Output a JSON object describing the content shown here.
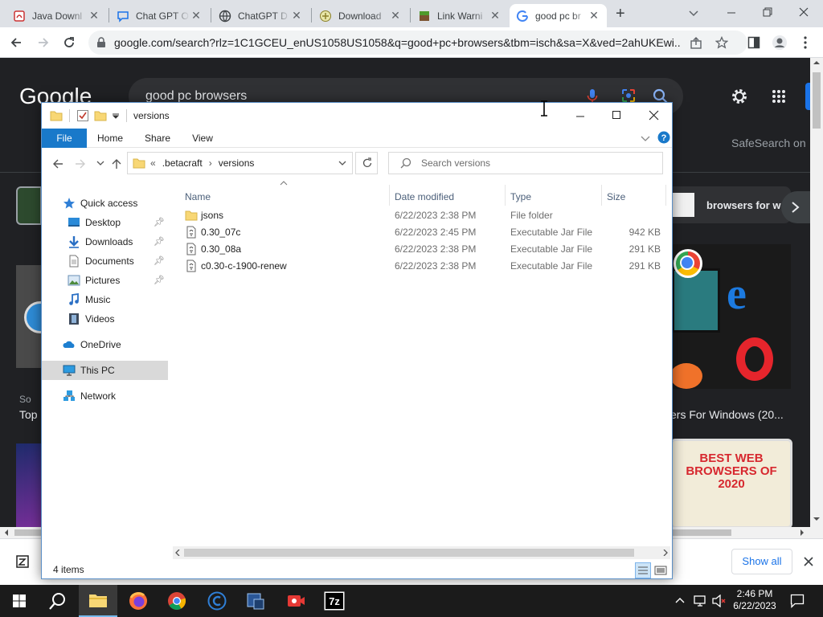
{
  "browser": {
    "tabs": [
      {
        "title": "Java Downl",
        "active": false
      },
      {
        "title": "Chat GPT O",
        "active": false
      },
      {
        "title": "ChatGPT D",
        "active": false
      },
      {
        "title": "Download",
        "active": false
      },
      {
        "title": "Link Warni",
        "active": false
      },
      {
        "title": "good pc br",
        "active": true
      }
    ],
    "new_tab": "+",
    "url": "google.com/search?rlz=1C1GCEU_enUS1058US1058&q=good+pc+browsers&tbm=isch&sa=X&ved=2ahUKEwi..."
  },
  "google": {
    "logo": "Google",
    "query": "good pc browsers",
    "safesearch": "SafeSearch on",
    "chip_text": "browsers for w",
    "left_caption_source": "So",
    "left_caption_title": "Top",
    "right_caption": "ers For Windows (20...",
    "best_web_line1": "BEST WEB",
    "best_web_line2": "BROWSERS OF",
    "best_web_line3": "2020",
    "show_all": "Show all"
  },
  "explorer": {
    "title": "versions",
    "ribbon": {
      "file": "File",
      "home": "Home",
      "share": "Share",
      "view": "View"
    },
    "breadcrumb": {
      "overflow": "«",
      "parent": ".betacraft",
      "sep": "›",
      "current": "versions"
    },
    "search_placeholder": "Search versions",
    "nav": {
      "quick_access": "Quick access",
      "desktop": "Desktop",
      "downloads": "Downloads",
      "documents": "Documents",
      "pictures": "Pictures",
      "music": "Music",
      "videos": "Videos",
      "onedrive": "OneDrive",
      "this_pc": "This PC",
      "network": "Network"
    },
    "columns": {
      "name": "Name",
      "date": "Date modified",
      "type": "Type",
      "size": "Size"
    },
    "files": [
      {
        "name": "jsons",
        "date": "6/22/2023 2:38 PM",
        "type": "File folder",
        "size": ""
      },
      {
        "name": "0.30_07c",
        "date": "6/22/2023 2:45 PM",
        "type": "Executable Jar File",
        "size": "942 KB"
      },
      {
        "name": "0.30_08a",
        "date": "6/22/2023 2:38 PM",
        "type": "Executable Jar File",
        "size": "291 KB"
      },
      {
        "name": "c0.30-c-1900-renew",
        "date": "6/22/2023 2:38 PM",
        "type": "Executable Jar File",
        "size": "291 KB"
      }
    ],
    "status": "4 items"
  },
  "taskbar": {
    "time": "2:46 PM",
    "date": "6/22/2023"
  },
  "colors": {
    "accent": "#1979ca",
    "google_bg": "#202124",
    "taskbar": "#1b1b1b"
  }
}
